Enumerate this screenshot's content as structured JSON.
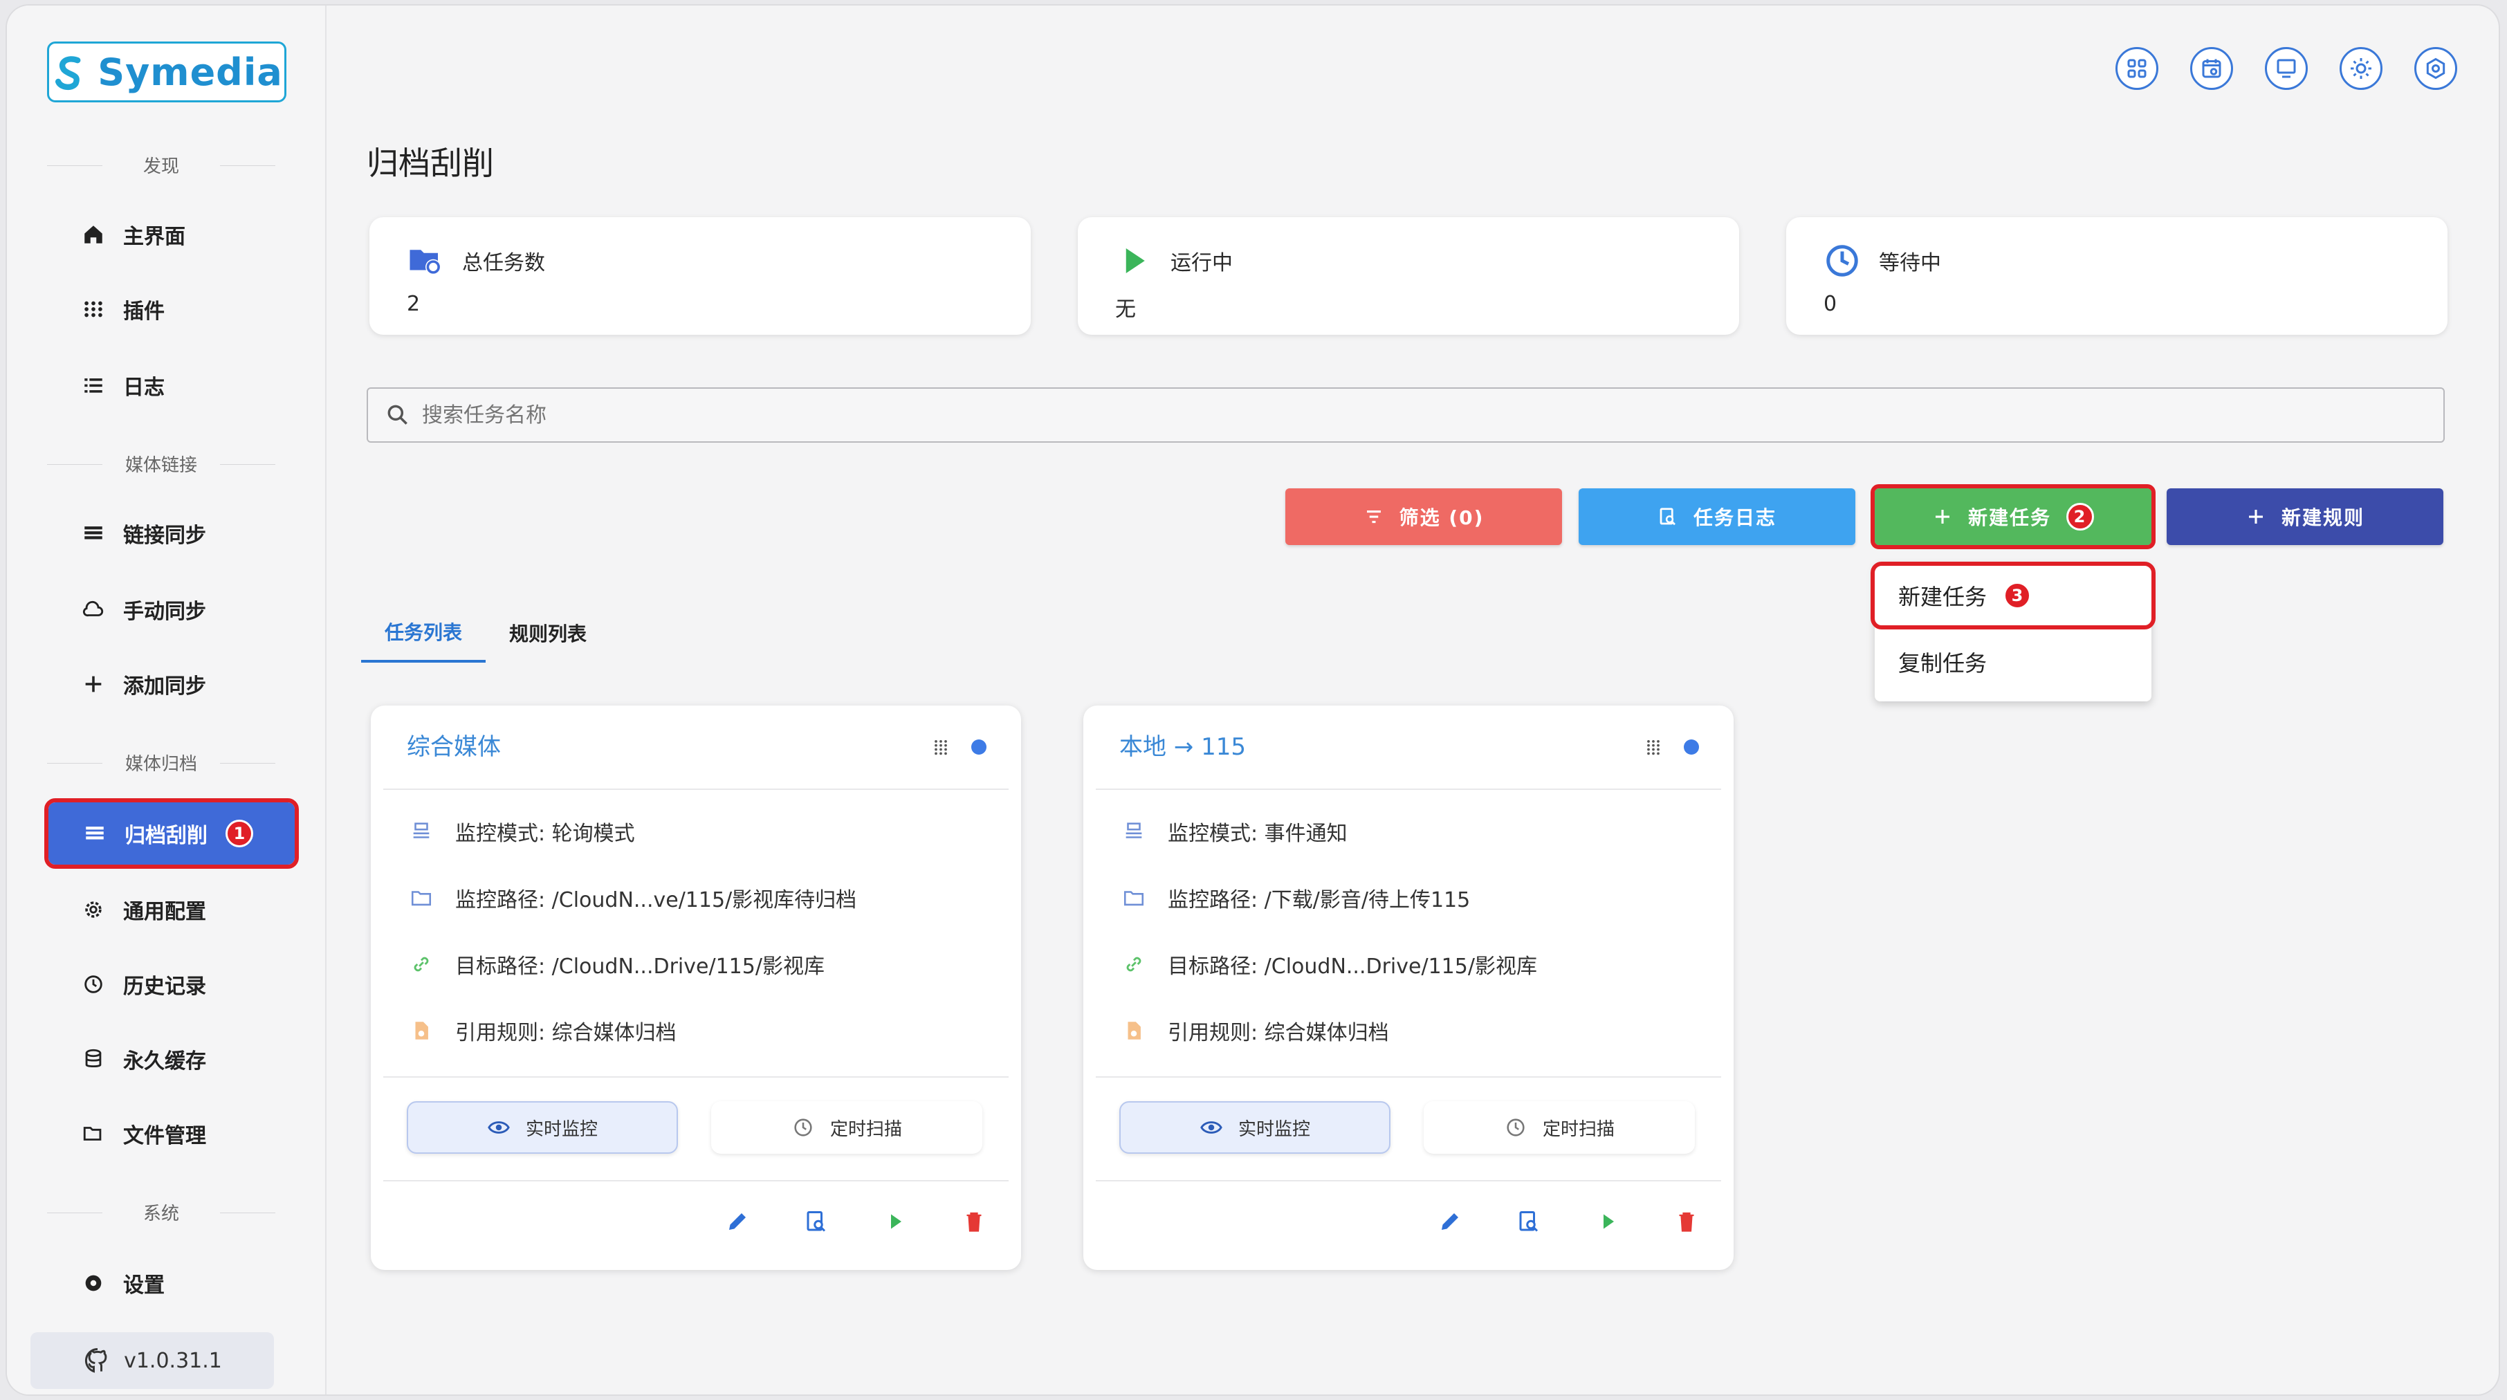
{
  "app": {
    "logo_text": "Symedia",
    "version": "v1.0.31.1"
  },
  "colors": {
    "primary": "#3f6ad8",
    "highlight": "#e01f26",
    "filter": "#ef6a64",
    "log": "#3ea3f0",
    "new_task": "#53b85d",
    "new_rule": "#3c4caa"
  },
  "sidebar": {
    "sections": [
      "发现",
      "媒体链接",
      "媒体归档",
      "系统"
    ],
    "items": [
      {
        "label": "主界面",
        "icon": "home-icon"
      },
      {
        "label": "插件",
        "icon": "grid-dots-icon"
      },
      {
        "label": "日志",
        "icon": "list-icon"
      },
      {
        "label": "链接同步",
        "icon": "table-icon"
      },
      {
        "label": "手动同步",
        "icon": "cloud-sync-icon"
      },
      {
        "label": "添加同步",
        "icon": "plus-icon"
      },
      {
        "label": "归档刮削",
        "icon": "table-icon",
        "active": true,
        "badge": "1"
      },
      {
        "label": "通用配置",
        "icon": "gear-icon"
      },
      {
        "label": "历史记录",
        "icon": "history-icon"
      },
      {
        "label": "永久缓存",
        "icon": "database-icon"
      },
      {
        "label": "文件管理",
        "icon": "folder-open-icon"
      },
      {
        "label": "设置",
        "icon": "settings-icon"
      }
    ]
  },
  "header": {
    "icons": [
      "apps-icon",
      "calendar-icon",
      "monitor-icon",
      "sun-icon",
      "settings-icon"
    ]
  },
  "page": {
    "title": "归档刮削"
  },
  "stats": [
    {
      "label": "总任务数",
      "value": "2",
      "icon": "folder-sync-icon"
    },
    {
      "label": "运行中",
      "value": "无",
      "icon": "play-icon"
    },
    {
      "label": "等待中",
      "value": "0",
      "icon": "clock-icon"
    }
  ],
  "search": {
    "placeholder": "搜索任务名称"
  },
  "toolbar": {
    "filter_label": "筛选 (0)",
    "log_label": "任务日志",
    "new_task_label": "新建任务",
    "new_task_badge": "2",
    "new_rule_label": "新建规则"
  },
  "dropdown": {
    "items": [
      {
        "label": "新建任务",
        "badge": "3"
      },
      {
        "label": "复制任务"
      }
    ]
  },
  "tabs": [
    {
      "label": "任务列表",
      "active": true
    },
    {
      "label": "规则列表",
      "active": false
    }
  ],
  "tasks": [
    {
      "title": "综合媒体",
      "rows": [
        "监控模式: 轮询模式",
        "监控路径: /CloudN...ve/115/影视库待归档",
        "目标路径: /CloudN...Drive/115/影视库",
        "引用规则: 综合媒体归档"
      ],
      "realtime_label": "实时监控",
      "schedule_label": "定时扫描"
    },
    {
      "title": "本地 → 115",
      "rows": [
        "监控模式: 事件通知",
        "监控路径: /下载/影音/待上传115",
        "目标路径: /CloudN...Drive/115/影视库",
        "引用规则: 综合媒体归档"
      ],
      "realtime_label": "实时监控",
      "schedule_label": "定时扫描"
    }
  ]
}
